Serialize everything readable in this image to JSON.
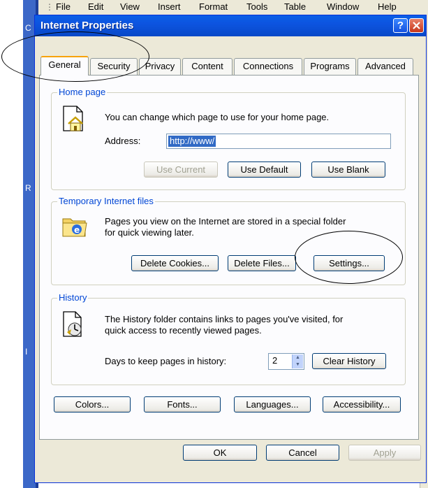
{
  "background": {
    "menu": [
      "File",
      "Edit",
      "View",
      "Insert",
      "Format",
      "Tools",
      "Table",
      "Window",
      "Help"
    ],
    "left_letters": [
      "C",
      "R",
      "I"
    ]
  },
  "dialog": {
    "title": "Internet Properties",
    "help_label": "?",
    "tabs": [
      "General",
      "Security",
      "Privacy",
      "Content",
      "Connections",
      "Programs",
      "Advanced"
    ],
    "active_tab": "General"
  },
  "home_page": {
    "title": "Home page",
    "description": "You can change which page to use for your home page.",
    "address_label": "Address:",
    "address_value": "http://www/",
    "buttons": {
      "use_current": "Use Current",
      "use_default": "Use Default",
      "use_blank": "Use Blank"
    }
  },
  "temp_files": {
    "title": "Temporary Internet files",
    "description_line1": "Pages you view on the Internet are stored in a special folder",
    "description_line2": "for quick viewing later.",
    "buttons": {
      "delete_cookies": "Delete Cookies...",
      "delete_files": "Delete Files...",
      "settings": "Settings..."
    }
  },
  "history": {
    "title": "History",
    "description_line1": "The History folder contains links to pages you've visited, for",
    "description_line2": "quick access to recently viewed pages.",
    "days_label": "Days to keep pages in history:",
    "days_value": "2",
    "clear_button": "Clear History"
  },
  "bottom_buttons": {
    "colors": "Colors...",
    "fonts": "Fonts...",
    "languages": "Languages...",
    "accessibility": "Accessibility..."
  },
  "dialog_buttons": {
    "ok": "OK",
    "cancel": "Cancel",
    "apply": "Apply"
  },
  "colors": {
    "titlebar": "#0a5fe6",
    "tab_highlight": "#f7a30b",
    "group_title": "#0046d5",
    "selection": "#316ac5"
  }
}
